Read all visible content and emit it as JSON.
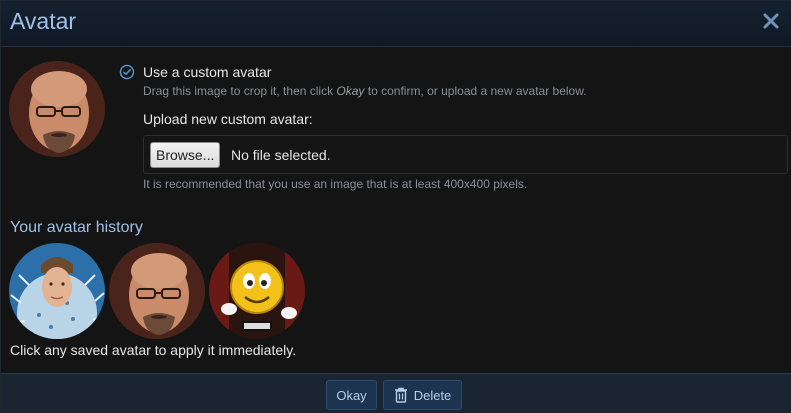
{
  "dialog": {
    "title": "Avatar",
    "close_label": "close"
  },
  "custom": {
    "radio_label": "Use a custom avatar",
    "hint_before": "Drag this image to crop it, then click ",
    "hint_okay": "Okay",
    "hint_after": " to confirm, or upload a new avatar below.",
    "upload_label": "Upload new custom avatar:",
    "browse_label": "Browse...",
    "file_status": "No file selected.",
    "recommend": "It is recommended that you use an image that is at least 400x400 pixels."
  },
  "history": {
    "title": "Your avatar history",
    "items": [
      {
        "name": "avatar-history-1",
        "icon": "man-portrait-pufferfish"
      },
      {
        "name": "avatar-history-2",
        "icon": "bald-man-glasses-portrait"
      },
      {
        "name": "avatar-history-3",
        "icon": "smiley-with-hands"
      }
    ],
    "note": "Click any saved avatar to apply it immediately."
  },
  "footer": {
    "okay_label": "Okay",
    "delete_label": "Delete"
  },
  "colors": {
    "accent": "#9fc0e6",
    "header_bg": "#162130",
    "button_bg": "#1d3450",
    "page_bg": "#141414"
  }
}
